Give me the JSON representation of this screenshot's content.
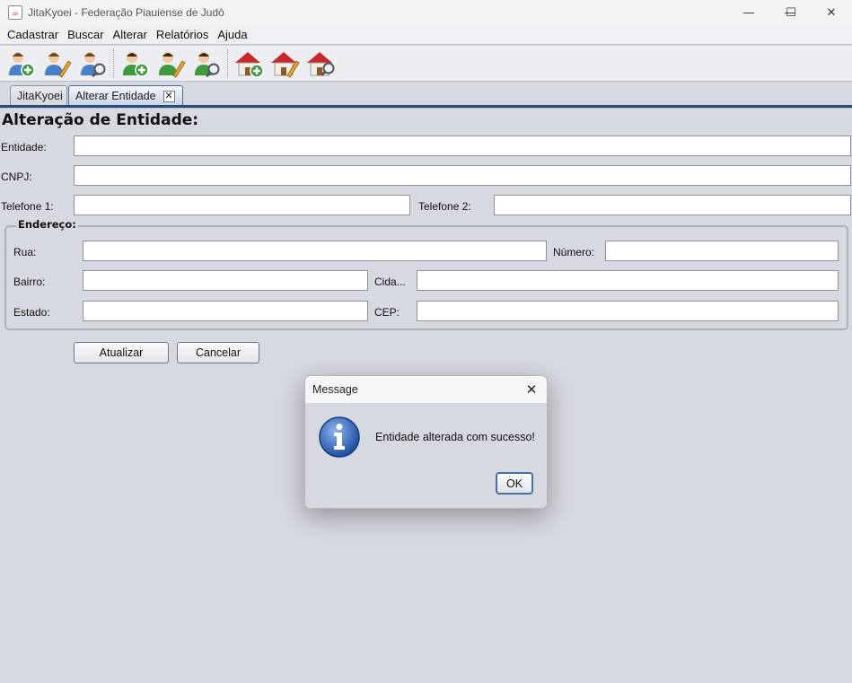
{
  "window": {
    "title": "JitaKyoei - Federação Piauiense de Judô",
    "minimize": "—",
    "maximize": "☐",
    "close": "✕"
  },
  "menubar": {
    "items": [
      "Cadastrar",
      "Buscar",
      "Alterar",
      "Relatórios",
      "Ajuda"
    ]
  },
  "toolbar": {
    "buttons": [
      {
        "icon": "user-add-icon"
      },
      {
        "icon": "user-edit-icon"
      },
      {
        "icon": "user-search-icon"
      },
      {
        "icon": "athlete-add-icon"
      },
      {
        "icon": "athlete-edit-icon"
      },
      {
        "icon": "athlete-search-icon"
      },
      {
        "icon": "house-add-icon"
      },
      {
        "icon": "house-edit-icon"
      },
      {
        "icon": "house-search-icon"
      }
    ]
  },
  "tabs": [
    {
      "label": "JitaKyoei"
    },
    {
      "label": "Alterar Entidade",
      "close": "✕"
    }
  ],
  "form": {
    "heading": "Alteração de Entidade:",
    "entidade_label": "Entidade:",
    "entidade_value": "",
    "cnpj_label": "CNPJ:",
    "cnpj_value": "",
    "telefone1_label": "Telefone 1:",
    "telefone1_value": "",
    "telefone2_label": "Telefone 2:",
    "telefone2_value": "",
    "endereco": {
      "title": "Endereço:",
      "rua_label": "Rua:",
      "rua_value": "",
      "numero_label": "Número:",
      "numero_value": "",
      "bairro_label": "Bairro:",
      "bairro_value": "",
      "cidade_label": "Cida...",
      "cidade_value": "",
      "estado_label": "Estado:",
      "estado_value": "",
      "cep_label": "CEP:",
      "cep_value": ""
    },
    "atualizar_label": "Atualizar",
    "cancelar_label": "Cancelar"
  },
  "dialog": {
    "title": "Message",
    "close": "✕",
    "icon": "info-icon",
    "message": "Entidade alterada com sucesso!",
    "ok_label": "OK"
  },
  "colors": {
    "background": "#d6d9df",
    "tab_accent": "#2e4a78",
    "info_blue": "#2f5fb3",
    "house_roof": "#c8282a",
    "person_green": "#3f9a3c"
  }
}
